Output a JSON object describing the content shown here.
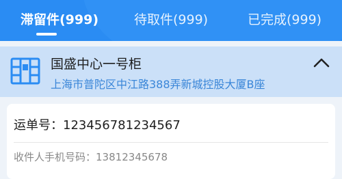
{
  "tabs": [
    {
      "label": "滞留件(999)",
      "active": true
    },
    {
      "label": "待取件(999)",
      "active": false
    },
    {
      "label": "已完成(999)",
      "active": false
    }
  ],
  "colors": {
    "primary": "#2a8cf3",
    "header_bg": "#cbe0f8",
    "address": "#3a86d8"
  },
  "locker": {
    "name": "国盛中心一号柜",
    "address": "上海市普陀区中江路388弄新城控股大厦B座",
    "icon": "locker-cabinet-icon",
    "collapse_icon": "chevron-up-icon"
  },
  "parcel": {
    "waybill_label": "运单号：",
    "waybill_value": "123456781234567",
    "phone_label": "收件人手机号码：",
    "phone_value": "13812345678"
  }
}
